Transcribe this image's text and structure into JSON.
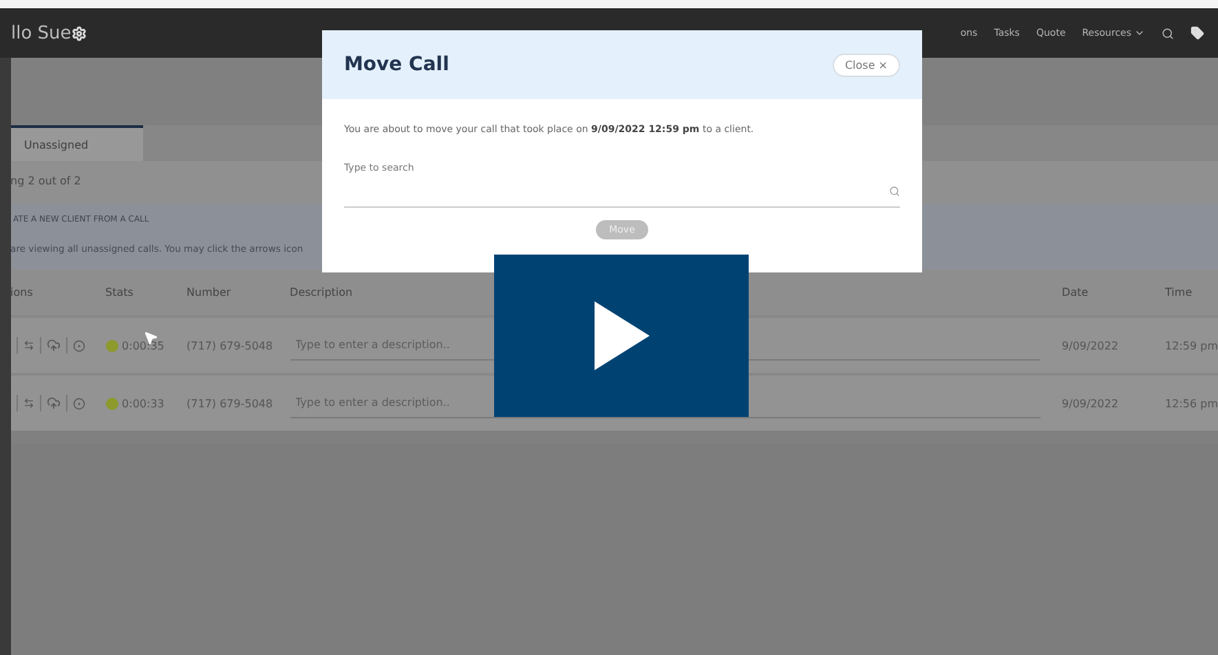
{
  "nav": {
    "user": "llo Sue",
    "items": [
      {
        "label": "ons",
        "menu": false
      },
      {
        "label": "Tasks",
        "menu": false
      },
      {
        "label": "Quote",
        "menu": false
      },
      {
        "label": "Resources",
        "menu": true
      }
    ]
  },
  "tabs": [
    {
      "label": "Unassigned",
      "selected": true
    }
  ],
  "summary": "ng 2 out of 2",
  "notice": {
    "title": "ATE A NEW CLIENT FROM A CALL",
    "text": "are viewing all unassigned calls. You may click the arrows icon"
  },
  "table": {
    "columns": [
      "ions",
      "Stats",
      "Number",
      "Description",
      "Date",
      "Time"
    ],
    "rows": [
      {
        "duration": "0:00:35",
        "number": "(717) 679-5048",
        "description_placeholder": "Type to enter a description..",
        "date": "9/09/2022",
        "time": "12:59 pm"
      },
      {
        "duration": "0:00:33",
        "number": "(717) 679-5048",
        "description_placeholder": "Type to enter a description..",
        "date": "9/09/2022",
        "time": "12:56 pm"
      }
    ]
  },
  "dialog": {
    "title": "Move Call",
    "close": "Close ×",
    "message": "You are about to move your call that took place on **9/09/2022 12:59 pm** to a client.",
    "search_label": "Type to search",
    "button": {
      "label": "Move",
      "disabled": true
    }
  }
}
